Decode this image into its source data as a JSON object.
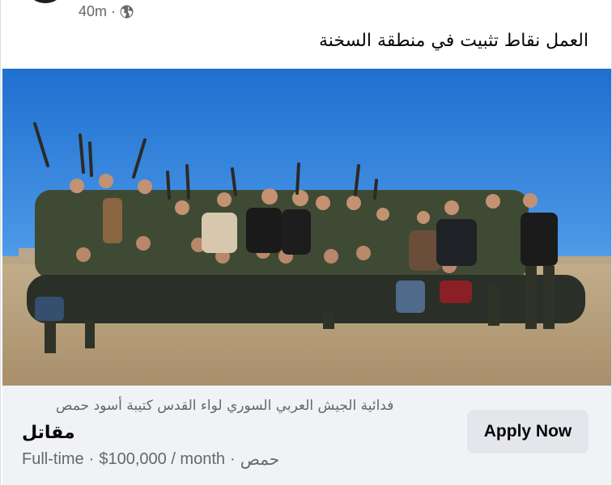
{
  "post": {
    "timestamp": "40m",
    "separator": "·",
    "audience_icon": "globe-icon",
    "text": "العمل نقاط تثبيت في منطقة السخنة"
  },
  "photo": {
    "subject": "group-of-soldiers-photo"
  },
  "job": {
    "organization": "فدائية الجيش العربي السوري لواء القدس كتيبة أسود حمص",
    "title": "مقاتل",
    "type": "Full-time",
    "salary": "$100,000 / month",
    "location": "حمص",
    "separator": "·",
    "apply_label": "Apply Now"
  },
  "colors": {
    "secondary_text": "#65676b",
    "primary_text": "#050505",
    "cta_background": "#f0f2f5",
    "button_background": "#e4e6eb"
  }
}
